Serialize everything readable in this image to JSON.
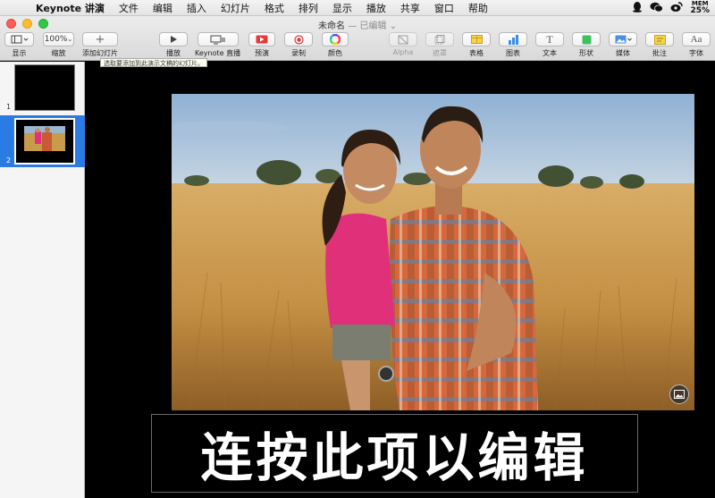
{
  "menubar": {
    "app_name": "Keynote 讲演",
    "items": [
      "文件",
      "编辑",
      "插入",
      "幻灯片",
      "格式",
      "排列",
      "显示",
      "播放",
      "共享",
      "窗口",
      "帮助"
    ],
    "mem_label": "MEM",
    "mem_value": "25%"
  },
  "window": {
    "title": "未命名",
    "status": "— 已编辑"
  },
  "toolbar": {
    "view": "显示",
    "zoom_value": "100%",
    "zoom": "缩放",
    "add_slide": "添加幻灯片",
    "play": "播放",
    "keynote_live": "Keynote 直播",
    "rehearse": "预演",
    "record": "录制",
    "colors": "颜色",
    "alpha": "Alpha",
    "mask": "遮罩",
    "table": "表格",
    "chart": "图表",
    "text": "文本",
    "shape": "形状",
    "media": "媒体",
    "comment": "批注",
    "font": "字体",
    "tooltip": "选取要添加到此演示文稿的幻灯片。"
  },
  "navigator": {
    "slides": [
      {
        "number": "1"
      },
      {
        "number": "2"
      }
    ]
  },
  "slide": {
    "placeholder_text": "连按此项以编辑"
  }
}
